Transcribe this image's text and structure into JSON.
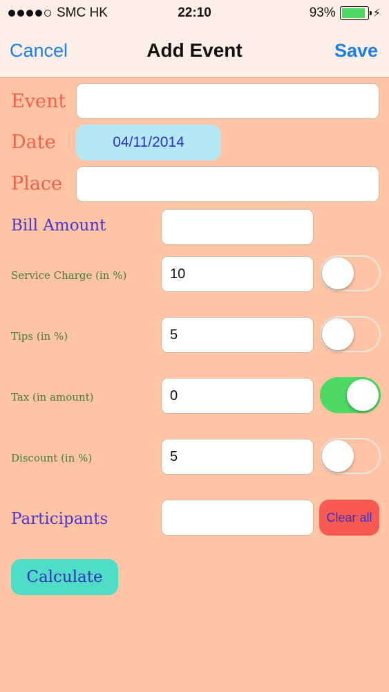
{
  "status_bar": {
    "carrier": "SMC HK",
    "time": "22:10",
    "battery_percent": "93%",
    "battery_level": 0.93,
    "signal_bars_filled": 4,
    "signal_bars_total": 5
  },
  "nav": {
    "cancel_label": "Cancel",
    "title": "Add Event",
    "save_label": "Save"
  },
  "form": {
    "event_label": "Event",
    "event_value": "",
    "date_label": "Date",
    "date_value": "04/11/2014",
    "place_label": "Place",
    "place_value": "",
    "bill_amount_label": "Bill Amount",
    "bill_amount_value": "",
    "service_charge_label": "Service Charge (in %)",
    "service_charge_value": "10",
    "service_charge_enabled": false,
    "tips_label": "Tips (in %)",
    "tips_value": "5",
    "tips_enabled": false,
    "tax_label": "Tax (in amount)",
    "tax_value": "0",
    "tax_enabled": true,
    "discount_label": "Discount (in %)",
    "discount_value": "5",
    "discount_enabled": false,
    "participants_label": "Participants",
    "participants_value": "",
    "clear_all_label": "Clear all",
    "calculate_label": "Calculate"
  },
  "colors": {
    "background": "#FFC4A3",
    "nav_accent": "#1E7FE0",
    "toggle_on": "#4CD964",
    "calculate_button": "#4FDDC8",
    "clear_button": "#F65A52",
    "date_button": "#B4E8F5"
  }
}
